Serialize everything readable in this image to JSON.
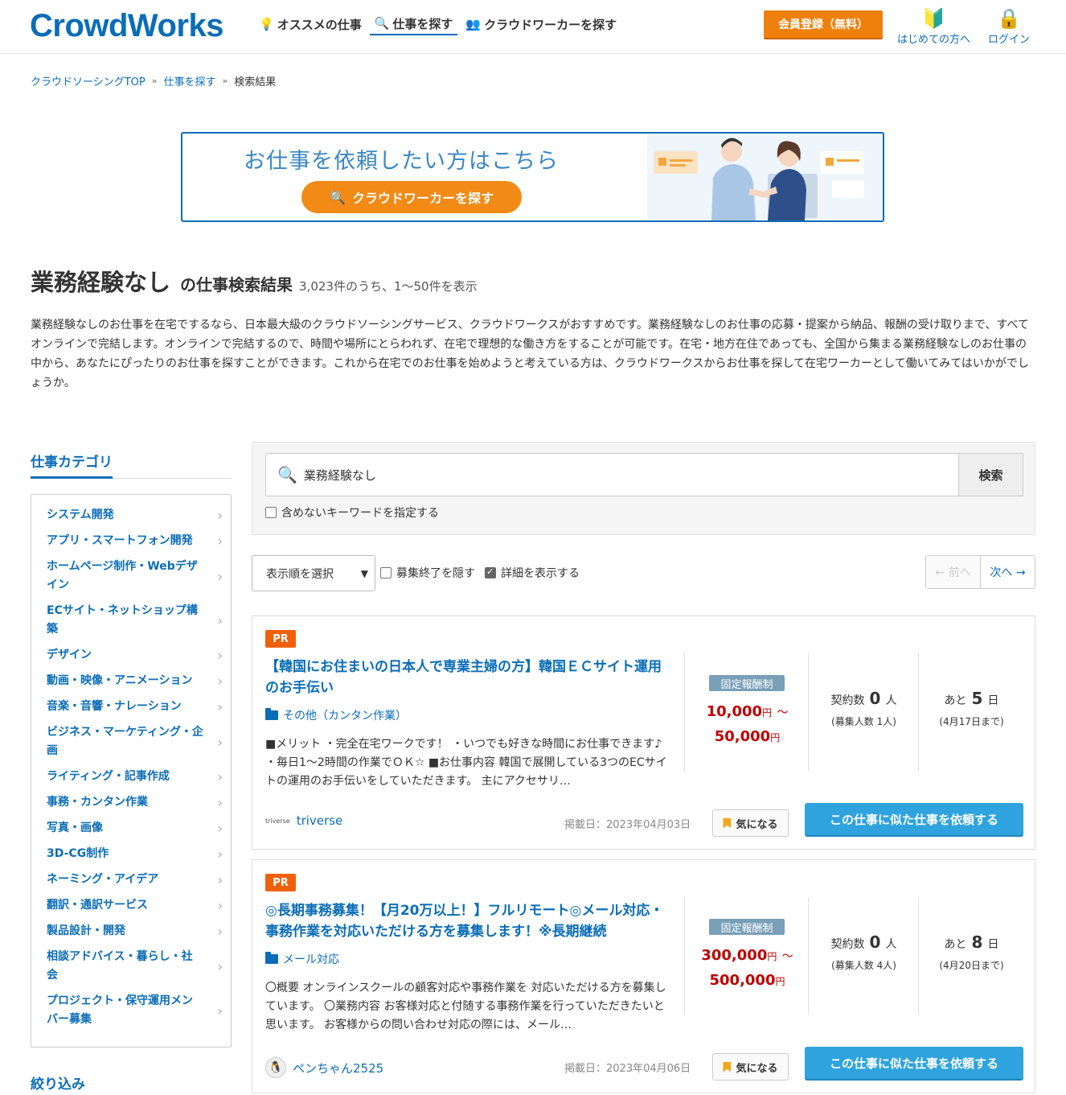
{
  "header": {
    "logo": "CrowdWorks",
    "nav": [
      {
        "label": "オススメの仕事",
        "icon": "lightbulb-icon"
      },
      {
        "label": "仕事を探す",
        "icon": "search-icon"
      },
      {
        "label": "クラウドワーカーを探す",
        "icon": "people-icon"
      }
    ],
    "register_label": "会員登録（無料）",
    "first_time_label": "はじめての方へ",
    "login_label": "ログイン"
  },
  "breadcrumb": [
    "クラウドソーシングTOP",
    "仕事を探す",
    "検索結果"
  ],
  "banner": {
    "title": "お仕事を依頼したい方はこちら",
    "button": "クラウドワーカーを探す"
  },
  "heading": {
    "keyword": "業務経験なし",
    "suffix": "の仕事検索結果",
    "count": "3,023件のうち、1〜50件を表示"
  },
  "intro": "業務経験なしのお仕事を在宅でするなら、日本最大級のクラウドソーシングサービス、クラウドワークスがおすすめです。業務経験なしのお仕事の応募・提案から納品、報酬の受け取りまで、すべてオンラインで完結します。オンラインで完結するので、時間や場所にとらわれず、在宅で理想的な働き方をすることが可能です。在宅・地方在住であっても、全国から集まる業務経験なしのお仕事の中から、あなたにぴったりのお仕事を探すことができます。これから在宅でのお仕事を始めようと考えている方は、クラウドワークスからお仕事を探して在宅ワーカーとして働いてみてはいかがでしょうか。",
  "sidebar": {
    "title": "仕事カテゴリ",
    "categories": [
      "システム開発",
      "アプリ・スマートフォン開発",
      "ホームページ制作・Webデザイン",
      "ECサイト・ネットショップ構築",
      "デザイン",
      "動画・映像・アニメーション",
      "音楽・音響・ナレーション",
      "ビジネス・マーケティング・企画",
      "ライティング・記事作成",
      "事務・カンタン作業",
      "写真・画像",
      "3D-CG制作",
      "ネーミング・アイデア",
      "翻訳・通訳サービス",
      "製品設計・開発",
      "相談アドバイス・暮らし・社会",
      "プロジェクト・保守運用メンバー募集"
    ],
    "filter_title": "絞り込み"
  },
  "search": {
    "value": "業務経験なし",
    "button": "検索",
    "exclude_label": "含めないキーワードを指定する",
    "exclude_checked": false
  },
  "controls": {
    "sort_label": "表示順を選択",
    "hide_closed_label": "募集終了を隠す",
    "hide_closed_checked": false,
    "show_detail_label": "詳細を表示する",
    "show_detail_checked": true,
    "prev": "← 前へ",
    "next": "次へ →"
  },
  "jobs": [
    {
      "badge": "PR",
      "title": "【韓国にお住まいの日本人で専業主婦の方】韓国ＥＣサイト運用のお手伝い",
      "category": "その他（カンタン作業）",
      "description": "■メリット ・完全在宅ワークです！ ・いつでも好きな時間にお仕事できます♪ ・毎日1〜2時間の作業でＯＫ☆ ■お仕事内容 韓国で展開している3つのECサイトの運用のお手伝いをしていただきます。 主にアクセサリ…",
      "client": "triverse",
      "client_logo": "triverse",
      "posted": "掲載日：2023年04月03日",
      "fav_label": "気になる",
      "request_label": "この仕事に似た仕事を依頼する",
      "pay_type": "固定報酬制",
      "pay_min": "10,000",
      "pay_max": "50,000",
      "pay_unit": "円",
      "pay_tilde": "〜",
      "contracts_label": "契約数",
      "contracts": "0",
      "contracts_unit": "人",
      "recruit": "(募集人数 1人)",
      "left_label": "あと",
      "days_left": "5",
      "days_unit": "日",
      "deadline": "(4月17日まで)"
    },
    {
      "badge": "PR",
      "title": "◎長期事務募集！【月20万以上！】フルリモート◎メール対応・事務作業を対応いただける方を募集します！※長期継続",
      "category": "メール対応",
      "description": "〇概要 オンラインスクールの顧客対応や事務作業を 対応いただける方を募集しています。 〇業務内容 お客様対応と付随する事務作業を行っていただきたいと思います。 お客様からの問い合わせ対応の際には、メール…",
      "client": "ペンちゃん2525",
      "client_logo": "",
      "posted": "掲載日：2023年04月06日",
      "fav_label": "気になる",
      "request_label": "この仕事に似た仕事を依頼する",
      "pay_type": "固定報酬制",
      "pay_min": "300,000",
      "pay_max": "500,000",
      "pay_unit": "円",
      "pay_tilde": "〜",
      "contracts_label": "契約数",
      "contracts": "0",
      "contracts_unit": "人",
      "recruit": "(募集人数 4人)",
      "left_label": "あと",
      "days_left": "8",
      "days_unit": "日",
      "deadline": "(4月20日まで)"
    }
  ]
}
